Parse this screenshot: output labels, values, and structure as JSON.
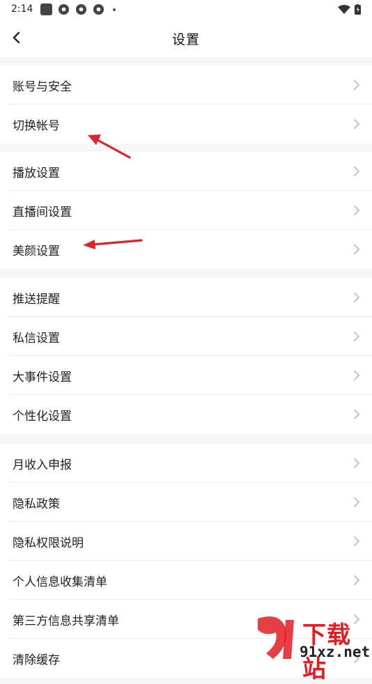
{
  "status": {
    "time": "2:14"
  },
  "header": {
    "title": "设置"
  },
  "groups": [
    {
      "items": [
        {
          "label": "账号与安全"
        },
        {
          "label": "切换帐号"
        }
      ]
    },
    {
      "items": [
        {
          "label": "播放设置"
        },
        {
          "label": "直播间设置"
        },
        {
          "label": "美颜设置"
        }
      ]
    },
    {
      "items": [
        {
          "label": "推送提醒"
        },
        {
          "label": "私信设置"
        },
        {
          "label": "大事件设置"
        },
        {
          "label": "个性化设置"
        }
      ]
    },
    {
      "items": [
        {
          "label": "月收入申报"
        },
        {
          "label": "隐私政策"
        },
        {
          "label": "隐私权限说明"
        },
        {
          "label": "个人信息收集清单"
        },
        {
          "label": "第三方信息共享清单"
        },
        {
          "label": "清除缓存"
        }
      ]
    }
  ],
  "watermark": {
    "main": "下载站",
    "sub": "91xz.net"
  },
  "colors": {
    "accent": "#e11d25",
    "chevron": "#bbbbbb",
    "background": "#f6f6f6"
  }
}
